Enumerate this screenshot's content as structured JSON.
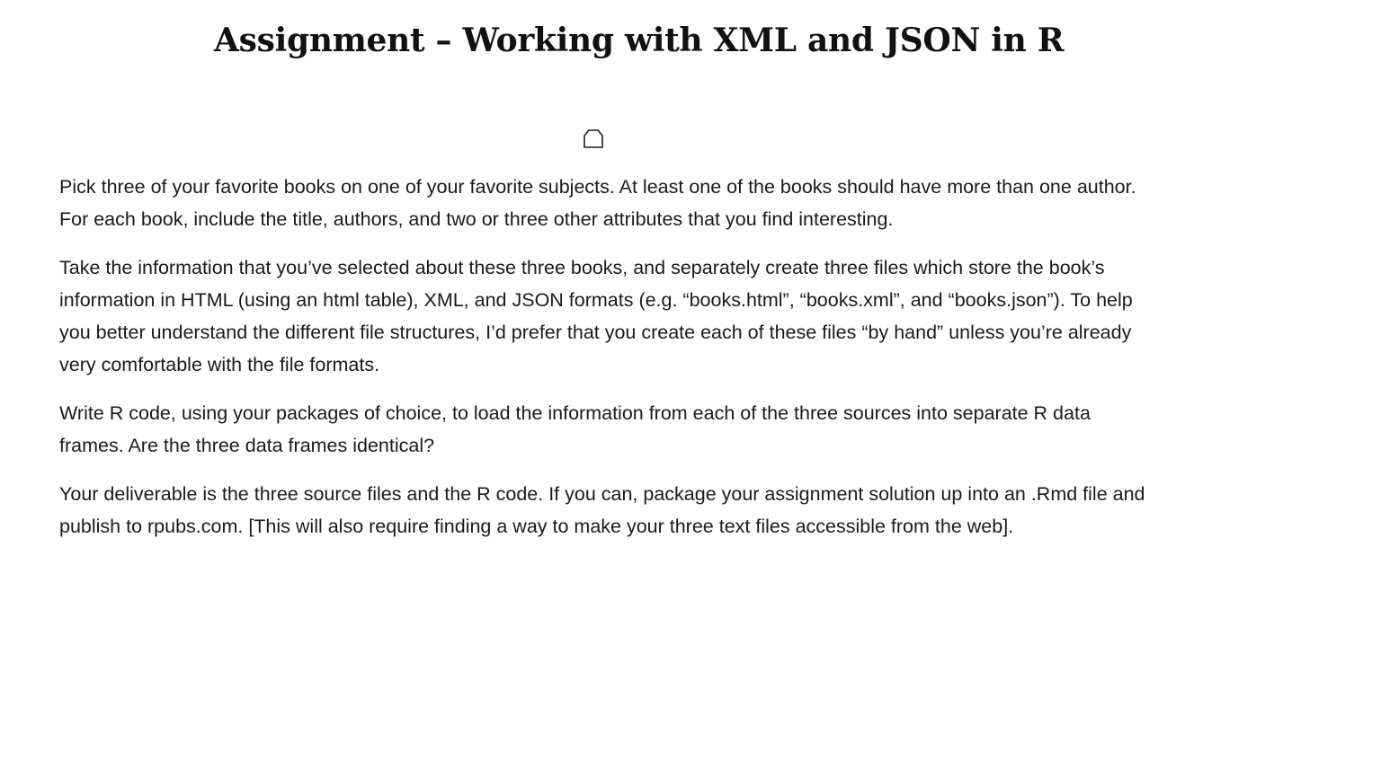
{
  "document": {
    "title": "Assignment – Working with XML and JSON in R",
    "paragraphs": [
      "Pick three of your favorite books on one of your favorite subjects.   At least one of the books should have more than one author.  For each book, include the title, authors, and two or three other attributes that you find interesting.",
      "Take the information that you’ve selected about these three books, and separately create three files which store the book’s information in HTML (using an html table), XML, and JSON formats (e.g.  “books.html”, “books.xml”, and “books.json”).  To help you better understand the different file structures, I’d prefer that you create each of these files “by hand” unless you’re already very comfortable with the file formats.",
      "Write R code, using your packages of choice, to load the information from each of the three sources into separate R data frames.   Are the three data frames identical?",
      "Your deliverable is the three source files and the R code.  If you can, package your assignment solution up into an .Rmd file and publish to rpubs.com.  [This will also require finding a way to make your three text files accessible from the web]."
    ],
    "icon": "anchor-marker-icon"
  }
}
